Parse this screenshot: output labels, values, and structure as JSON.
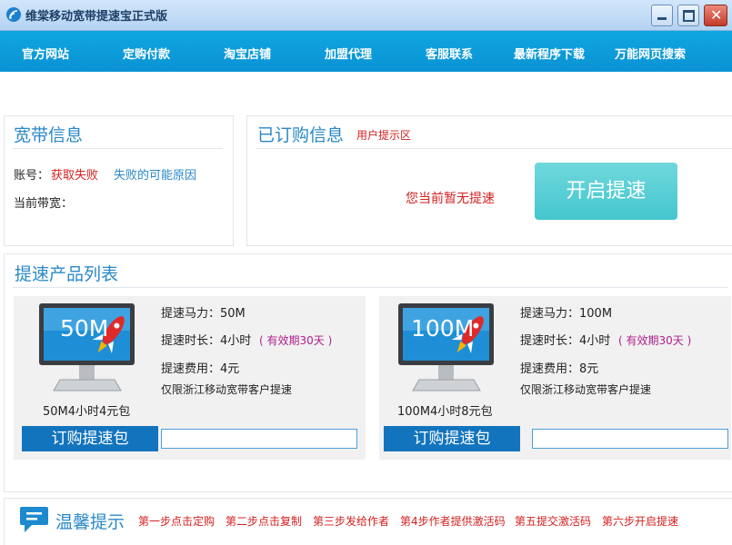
{
  "window": {
    "title": "维棠移动宽带提速宝正式版"
  },
  "nav": {
    "items": [
      "官方网站",
      "定购付款",
      "淘宝店铺",
      "加盟代理",
      "客服联系",
      "最新程序下载",
      "万能网页搜索"
    ]
  },
  "broadband": {
    "title": "宽带信息",
    "account_label": "账号：",
    "account_value": "获取失败",
    "fail_reason_link": "失败的可能原因",
    "current_bw_label": "当前带宽："
  },
  "ordered": {
    "title": "已订购信息",
    "hint": "用户提示区",
    "status": "您当前暂无提速",
    "start_button": "开启提速"
  },
  "products": {
    "title": "提速产品列表",
    "items": [
      {
        "screen_label": "50M",
        "package_name": "50M4小时4元包",
        "power": "提速马力：50M",
        "duration": "提速时长：4小时",
        "validity": "( 有效期30天 )",
        "fee": "提速费用：4元",
        "restriction": "仅限浙江移动宽带客户提速",
        "order_button": "订购提速包",
        "input_value": ""
      },
      {
        "screen_label": "100M",
        "package_name": "100M4小时8元包",
        "power": "提速马力：100M",
        "duration": "提速时长：4小时",
        "validity": "( 有效期30天 )",
        "fee": "提速费用：8元",
        "restriction": "仅限浙江移动宽带客户提速",
        "order_button": "订购提速包",
        "input_value": ""
      }
    ]
  },
  "tips": {
    "title": "温馨提示",
    "steps": [
      "第一步点击定购",
      "第二步点击复制",
      "第三步发给作者",
      "第4步作者提供激活码",
      "第五提交激活码",
      "第六步开启提速"
    ]
  },
  "colors": {
    "nav_bg": "#0b92d4",
    "accent_blue": "#2a88c8",
    "alert_red": "#d42020",
    "start_button": "#44c6cf"
  }
}
